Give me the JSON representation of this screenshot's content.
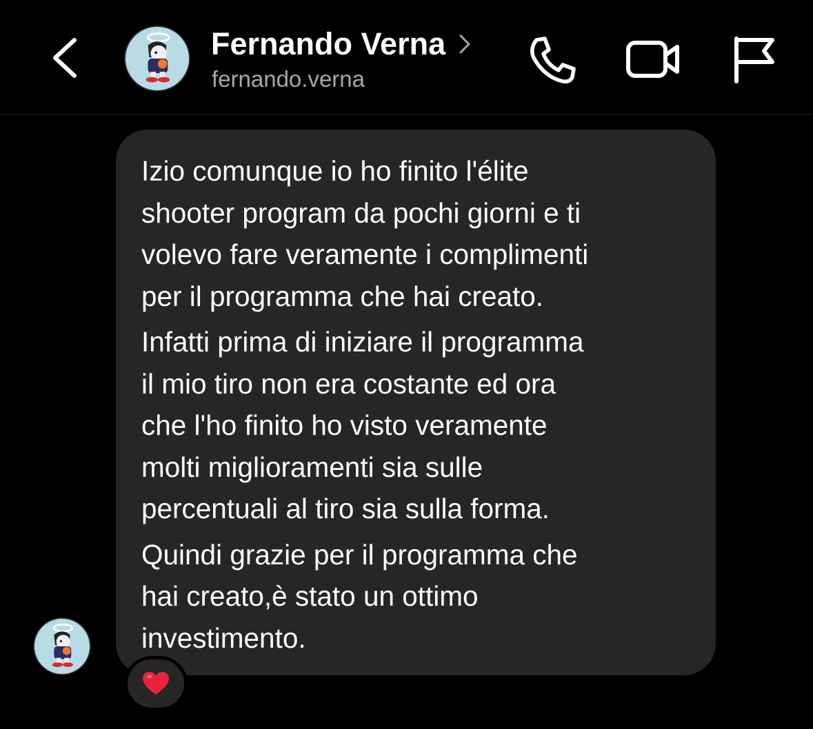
{
  "header": {
    "contact_name": "Fernando Verna",
    "username": "fernando.verna",
    "icons": [
      "back-icon",
      "chevron-right-icon",
      "phone-icon",
      "video-camera-icon",
      "flag-icon"
    ]
  },
  "message": {
    "paragraphs": [
      {
        "lines": [
          "Izio comunque io ho finito l'élite",
          "shooter program da pochi giorni e ti",
          "volevo fare veramente i complimenti",
          "per il programma che hai creato."
        ]
      },
      {
        "lines": [
          "Infatti prima di iniziare il programma",
          "il mio tiro non era costante ed ora",
          "che l'ho finito ho visto veramente",
          "molti miglioramenti sia sulle",
          "percentuali al tiro sia sulla forma."
        ]
      },
      {
        "lines": [
          "Quindi grazie per il programma che",
          "hai creato,è stato un ottimo",
          "investimento."
        ]
      }
    ],
    "reaction": "heart-emoji"
  },
  "colors": {
    "background": "#000000",
    "bubble": "#262626",
    "text_primary": "#ffffff",
    "text_secondary": "#a8a8a8",
    "reaction_heart": "#e8243c",
    "avatar_bg": "#b8dbe6"
  }
}
